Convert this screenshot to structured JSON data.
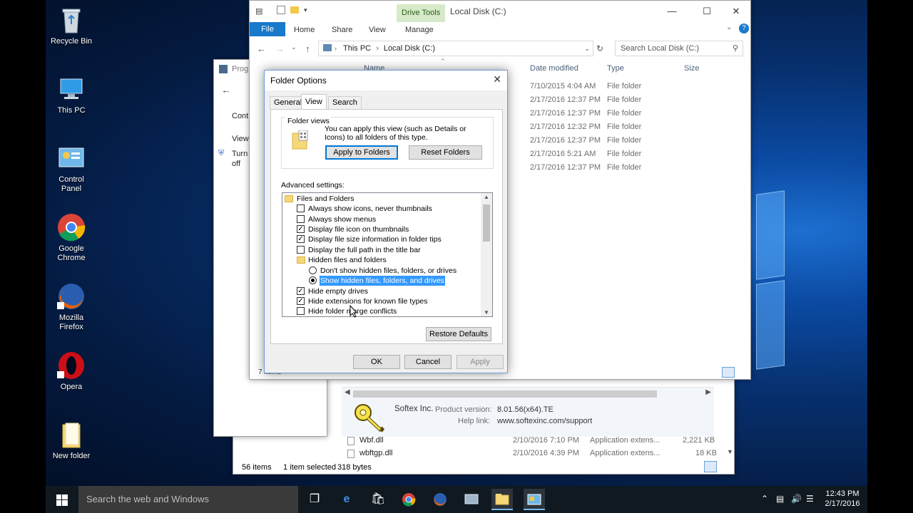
{
  "desktop": {
    "icons": [
      {
        "label": "Recycle Bin",
        "icon": "recycle-bin-icon"
      },
      {
        "label": "This PC",
        "icon": "computer-icon"
      },
      {
        "label": "Control Panel",
        "icon": "control-panel-icon"
      },
      {
        "label": "Google Chrome",
        "icon": "chrome-icon"
      },
      {
        "label": "Mozilla Firefox",
        "icon": "firefox-icon"
      },
      {
        "label": "Opera",
        "icon": "opera-icon"
      },
      {
        "label": "New folder",
        "icon": "folder-icon"
      }
    ]
  },
  "back_window": {
    "title": "Local Disk (C:)",
    "context_tab": "Drive Tools",
    "ribbon_tabs": [
      "File",
      "Home",
      "Share",
      "View",
      "Manage"
    ],
    "address": {
      "crumb1": "This PC",
      "crumb2": "Local Disk (C:)"
    },
    "search_placeholder": "Search Local Disk (C:)",
    "columns": {
      "name": "Name",
      "date": "Date modified",
      "type": "Type",
      "size": "Size"
    },
    "rows": [
      {
        "date": "7/10/2015 4:04 AM",
        "type": "File folder"
      },
      {
        "date": "2/17/2016 12:37 PM",
        "type": "File folder"
      },
      {
        "date": "2/17/2016 12:37 PM",
        "type": "File folder"
      },
      {
        "date": "2/17/2016 12:32 PM",
        "type": "File folder"
      },
      {
        "date": "2/17/2016 12:37 PM",
        "type": "File folder"
      },
      {
        "date": "2/17/2016 5:21 AM",
        "type": "File folder"
      },
      {
        "date": "2/17/2016 12:37 PM",
        "type": "File folder"
      }
    ],
    "status_count": "7 items"
  },
  "control_panel": {
    "title": "Prog",
    "texts": [
      "Cont",
      "View",
      "Turn",
      "off"
    ]
  },
  "lower_window": {
    "details": {
      "company": "Softex Inc.",
      "product_version_label": "Product version:",
      "product_version": "8.01.56(x64).TE",
      "help_link_label": "Help link:",
      "help_link": "www.softexinc.com/support"
    },
    "rows": [
      {
        "name": "Wbf.dll",
        "date": "2/10/2016 7:10 PM",
        "type": "Application extens...",
        "size": "2,221 KB"
      },
      {
        "name": "wbftgp.dll",
        "date": "2/10/2016 4:39 PM",
        "type": "Application extens...",
        "size": "18 KB"
      }
    ],
    "status": {
      "count": "56 items",
      "selected": "1 item selected",
      "size": "318 bytes"
    }
  },
  "folder_options": {
    "title": "Folder Options",
    "tabs": [
      "General",
      "View",
      "Search"
    ],
    "folder_views": {
      "heading": "Folder views",
      "description": "You can apply this view (such as Details or Icons) to all folders of this type.",
      "apply_button": "Apply to Folders",
      "reset_button": "Reset Folders"
    },
    "advanced_label": "Advanced settings:",
    "tree": [
      {
        "kind": "folder",
        "label": "Files and Folders",
        "indent": 0
      },
      {
        "kind": "check",
        "label": "Always show icons, never thumbnails",
        "checked": false,
        "indent": 1
      },
      {
        "kind": "check",
        "label": "Always show menus",
        "checked": false,
        "indent": 1
      },
      {
        "kind": "check",
        "label": "Display file icon on thumbnails",
        "checked": true,
        "indent": 1
      },
      {
        "kind": "check",
        "label": "Display file size information in folder tips",
        "checked": true,
        "indent": 1
      },
      {
        "kind": "check",
        "label": "Display the full path in the title bar",
        "checked": false,
        "indent": 1
      },
      {
        "kind": "folder",
        "label": "Hidden files and folders",
        "indent": 1
      },
      {
        "kind": "radio",
        "label": "Don't show hidden files, folders, or drives",
        "checked": false,
        "indent": 2
      },
      {
        "kind": "radio",
        "label": "Show hidden files, folders, and drives",
        "checked": true,
        "indent": 2,
        "selected": true
      },
      {
        "kind": "check",
        "label": "Hide empty drives",
        "checked": true,
        "indent": 1
      },
      {
        "kind": "check",
        "label": "Hide extensions for known file types",
        "checked": true,
        "indent": 1
      },
      {
        "kind": "check",
        "label": "Hide folder merge conflicts",
        "checked": false,
        "indent": 1
      }
    ],
    "restore_button": "Restore Defaults",
    "ok_button": "OK",
    "cancel_button": "Cancel",
    "apply_button": "Apply"
  },
  "taskbar": {
    "search_placeholder": "Search the web and Windows",
    "time": "12:43 PM",
    "date": "2/17/2016"
  },
  "colors": {
    "accent": "#0078d7",
    "selection": "#3399ff",
    "file_tab": "#1979ca",
    "drive_tools": "#d6eac9"
  }
}
